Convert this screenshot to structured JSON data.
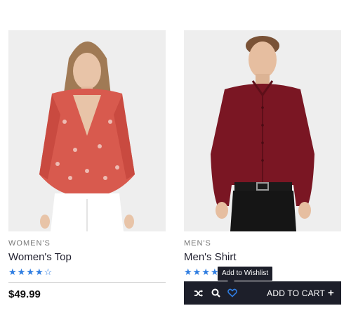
{
  "products": [
    {
      "category": "WOMEN'S",
      "title": "Women's Top",
      "rating": 4,
      "rating_max": 5,
      "price": "$49.99"
    },
    {
      "category": "MEN'S",
      "title": "Men's Shirt",
      "rating": 4,
      "rating_max": 5
    }
  ],
  "tooltip": "Add to Wishlist",
  "actions": {
    "compare_icon": "shuffle-icon",
    "quickview_icon": "search-icon",
    "wishlist_icon": "heart-icon",
    "add_to_cart_label": "ADD TO CART",
    "add_icon": "plus-icon"
  },
  "colors": {
    "accent": "#2f7de1",
    "bar": "#1d1f2a"
  }
}
